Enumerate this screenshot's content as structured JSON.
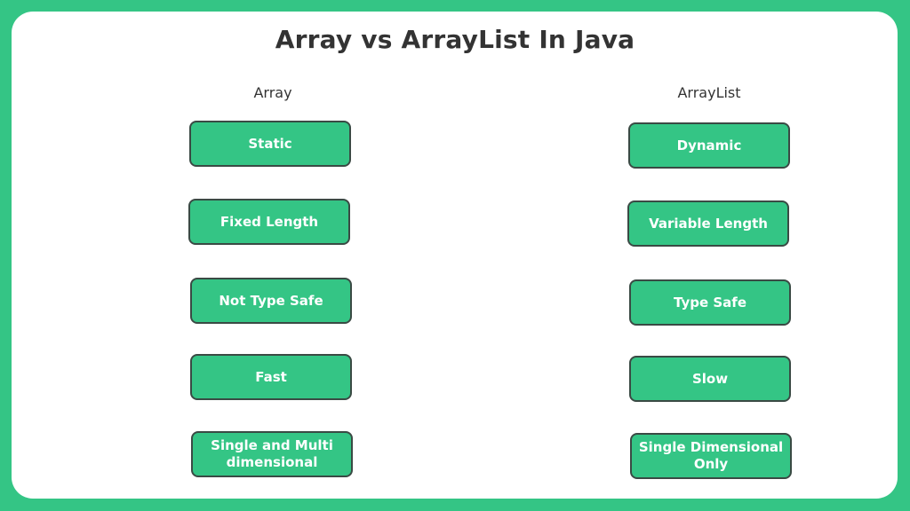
{
  "title": "Array vs ArrayList In Java",
  "colors": {
    "accent": "#34c585",
    "border": "#3a4a44",
    "text": "#333333"
  },
  "columns": [
    {
      "heading": "Array",
      "items": [
        "Static",
        "Fixed Length",
        "Not Type Safe",
        "Fast",
        "Single and Multi dimensional"
      ]
    },
    {
      "heading": "ArrayList",
      "items": [
        "Dynamic",
        "Variable Length",
        "Type Safe",
        "Slow",
        "Single Dimensional Only"
      ]
    }
  ]
}
